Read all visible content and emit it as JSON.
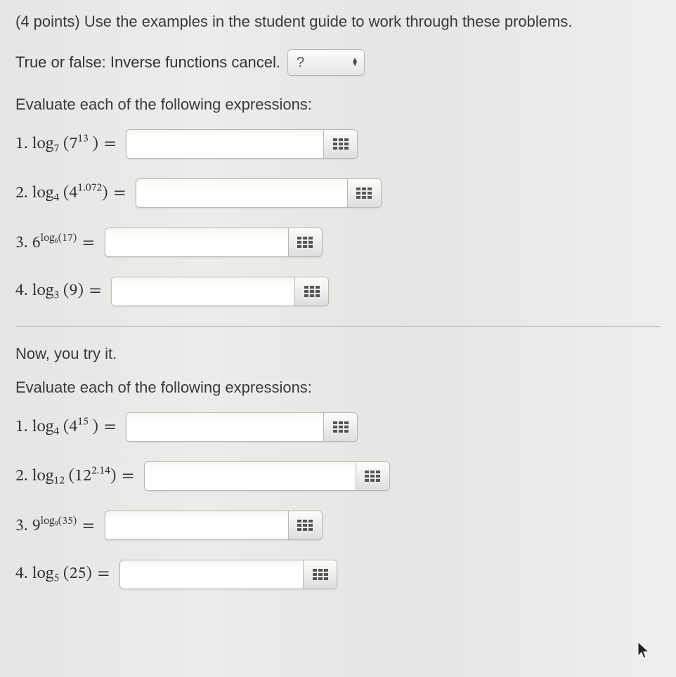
{
  "header": {
    "points_label": "(4 points)",
    "instructions": "Use the examples in the student guide to work through these problems."
  },
  "true_false": {
    "prompt": "True or false: Inverse functions cancel.",
    "selected": "?"
  },
  "section1": {
    "heading": "Evaluate each of the following expressions:",
    "items": [
      {
        "num": "1.",
        "expr_html": "log<sub>7</sub> (7<sup>13</sup> )",
        "value": ""
      },
      {
        "num": "2.",
        "expr_html": "log<sub>4</sub> (4<sup>1.072</sup>)",
        "value": ""
      },
      {
        "num": "3.",
        "expr_html": "6<sup>log<sub>6</sub>(17)</sup>",
        "value": ""
      },
      {
        "num": "4.",
        "expr_html": "log<sub>3</sub> (9)",
        "value": ""
      }
    ]
  },
  "section2": {
    "lead": "Now, you try it.",
    "heading": "Evaluate each of the following expressions:",
    "items": [
      {
        "num": "1.",
        "expr_html": "log<sub>4</sub> (4<sup>15</sup> )",
        "value": ""
      },
      {
        "num": "2.",
        "expr_html": "log<sub>12</sub> (12<sup>2.14</sup>)",
        "value": ""
      },
      {
        "num": "3.",
        "expr_html": "9<sup>log<sub>9</sub>(35)</sup>",
        "value": ""
      },
      {
        "num": "4.",
        "expr_html": "log<sub>5</sub> (25)",
        "value": ""
      }
    ]
  }
}
